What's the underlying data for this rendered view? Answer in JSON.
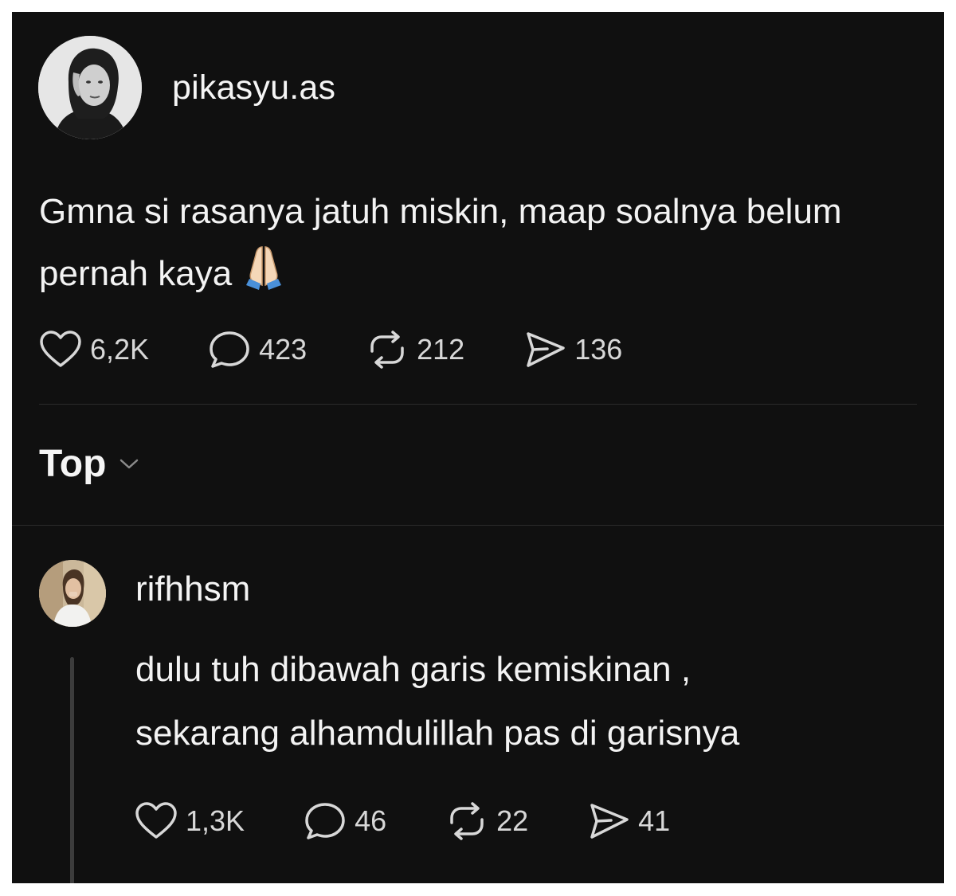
{
  "post": {
    "username": "pikasyu.as",
    "text": "Gmna si rasanya jatuh miskin, maap soalnya belum pernah kaya",
    "emoji": "🙏🏻",
    "stats": {
      "likes": "6,2K",
      "comments": "423",
      "reposts": "212",
      "shares": "136"
    }
  },
  "sort": {
    "label": "Top",
    "icon": "chevron-down-icon"
  },
  "reply": {
    "username": "rifhhsm",
    "text_line1": "dulu tuh dibawah garis kemiskinan ,",
    "text_line2": "sekarang alhamdulillah pas di garisnya",
    "stats": {
      "likes": "1,3K",
      "comments": "46",
      "reposts": "22",
      "shares": "41"
    }
  },
  "colors": {
    "background": "#101010",
    "text": "#f3f3f3",
    "icon": "#d8d8d8",
    "divider": "#2b2b2b"
  }
}
